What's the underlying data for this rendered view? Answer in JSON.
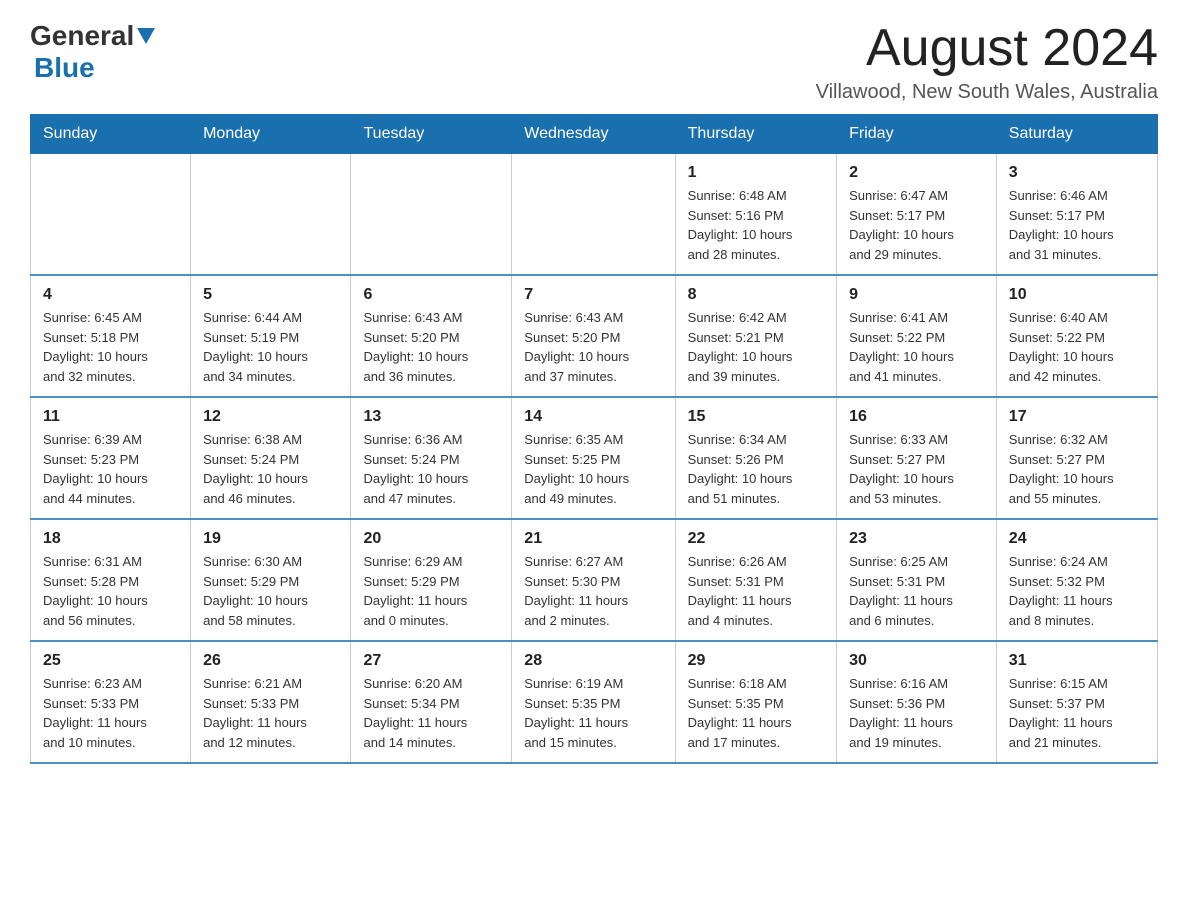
{
  "header": {
    "logo_general": "General",
    "logo_blue": "Blue",
    "month_title": "August 2024",
    "location": "Villawood, New South Wales, Australia"
  },
  "days_of_week": [
    "Sunday",
    "Monday",
    "Tuesday",
    "Wednesday",
    "Thursday",
    "Friday",
    "Saturday"
  ],
  "weeks": [
    [
      {
        "day": "",
        "info": ""
      },
      {
        "day": "",
        "info": ""
      },
      {
        "day": "",
        "info": ""
      },
      {
        "day": "",
        "info": ""
      },
      {
        "day": "1",
        "info": "Sunrise: 6:48 AM\nSunset: 5:16 PM\nDaylight: 10 hours\nand 28 minutes."
      },
      {
        "day": "2",
        "info": "Sunrise: 6:47 AM\nSunset: 5:17 PM\nDaylight: 10 hours\nand 29 minutes."
      },
      {
        "day": "3",
        "info": "Sunrise: 6:46 AM\nSunset: 5:17 PM\nDaylight: 10 hours\nand 31 minutes."
      }
    ],
    [
      {
        "day": "4",
        "info": "Sunrise: 6:45 AM\nSunset: 5:18 PM\nDaylight: 10 hours\nand 32 minutes."
      },
      {
        "day": "5",
        "info": "Sunrise: 6:44 AM\nSunset: 5:19 PM\nDaylight: 10 hours\nand 34 minutes."
      },
      {
        "day": "6",
        "info": "Sunrise: 6:43 AM\nSunset: 5:20 PM\nDaylight: 10 hours\nand 36 minutes."
      },
      {
        "day": "7",
        "info": "Sunrise: 6:43 AM\nSunset: 5:20 PM\nDaylight: 10 hours\nand 37 minutes."
      },
      {
        "day": "8",
        "info": "Sunrise: 6:42 AM\nSunset: 5:21 PM\nDaylight: 10 hours\nand 39 minutes."
      },
      {
        "day": "9",
        "info": "Sunrise: 6:41 AM\nSunset: 5:22 PM\nDaylight: 10 hours\nand 41 minutes."
      },
      {
        "day": "10",
        "info": "Sunrise: 6:40 AM\nSunset: 5:22 PM\nDaylight: 10 hours\nand 42 minutes."
      }
    ],
    [
      {
        "day": "11",
        "info": "Sunrise: 6:39 AM\nSunset: 5:23 PM\nDaylight: 10 hours\nand 44 minutes."
      },
      {
        "day": "12",
        "info": "Sunrise: 6:38 AM\nSunset: 5:24 PM\nDaylight: 10 hours\nand 46 minutes."
      },
      {
        "day": "13",
        "info": "Sunrise: 6:36 AM\nSunset: 5:24 PM\nDaylight: 10 hours\nand 47 minutes."
      },
      {
        "day": "14",
        "info": "Sunrise: 6:35 AM\nSunset: 5:25 PM\nDaylight: 10 hours\nand 49 minutes."
      },
      {
        "day": "15",
        "info": "Sunrise: 6:34 AM\nSunset: 5:26 PM\nDaylight: 10 hours\nand 51 minutes."
      },
      {
        "day": "16",
        "info": "Sunrise: 6:33 AM\nSunset: 5:27 PM\nDaylight: 10 hours\nand 53 minutes."
      },
      {
        "day": "17",
        "info": "Sunrise: 6:32 AM\nSunset: 5:27 PM\nDaylight: 10 hours\nand 55 minutes."
      }
    ],
    [
      {
        "day": "18",
        "info": "Sunrise: 6:31 AM\nSunset: 5:28 PM\nDaylight: 10 hours\nand 56 minutes."
      },
      {
        "day": "19",
        "info": "Sunrise: 6:30 AM\nSunset: 5:29 PM\nDaylight: 10 hours\nand 58 minutes."
      },
      {
        "day": "20",
        "info": "Sunrise: 6:29 AM\nSunset: 5:29 PM\nDaylight: 11 hours\nand 0 minutes."
      },
      {
        "day": "21",
        "info": "Sunrise: 6:27 AM\nSunset: 5:30 PM\nDaylight: 11 hours\nand 2 minutes."
      },
      {
        "day": "22",
        "info": "Sunrise: 6:26 AM\nSunset: 5:31 PM\nDaylight: 11 hours\nand 4 minutes."
      },
      {
        "day": "23",
        "info": "Sunrise: 6:25 AM\nSunset: 5:31 PM\nDaylight: 11 hours\nand 6 minutes."
      },
      {
        "day": "24",
        "info": "Sunrise: 6:24 AM\nSunset: 5:32 PM\nDaylight: 11 hours\nand 8 minutes."
      }
    ],
    [
      {
        "day": "25",
        "info": "Sunrise: 6:23 AM\nSunset: 5:33 PM\nDaylight: 11 hours\nand 10 minutes."
      },
      {
        "day": "26",
        "info": "Sunrise: 6:21 AM\nSunset: 5:33 PM\nDaylight: 11 hours\nand 12 minutes."
      },
      {
        "day": "27",
        "info": "Sunrise: 6:20 AM\nSunset: 5:34 PM\nDaylight: 11 hours\nand 14 minutes."
      },
      {
        "day": "28",
        "info": "Sunrise: 6:19 AM\nSunset: 5:35 PM\nDaylight: 11 hours\nand 15 minutes."
      },
      {
        "day": "29",
        "info": "Sunrise: 6:18 AM\nSunset: 5:35 PM\nDaylight: 11 hours\nand 17 minutes."
      },
      {
        "day": "30",
        "info": "Sunrise: 6:16 AM\nSunset: 5:36 PM\nDaylight: 11 hours\nand 19 minutes."
      },
      {
        "day": "31",
        "info": "Sunrise: 6:15 AM\nSunset: 5:37 PM\nDaylight: 11 hours\nand 21 minutes."
      }
    ]
  ]
}
